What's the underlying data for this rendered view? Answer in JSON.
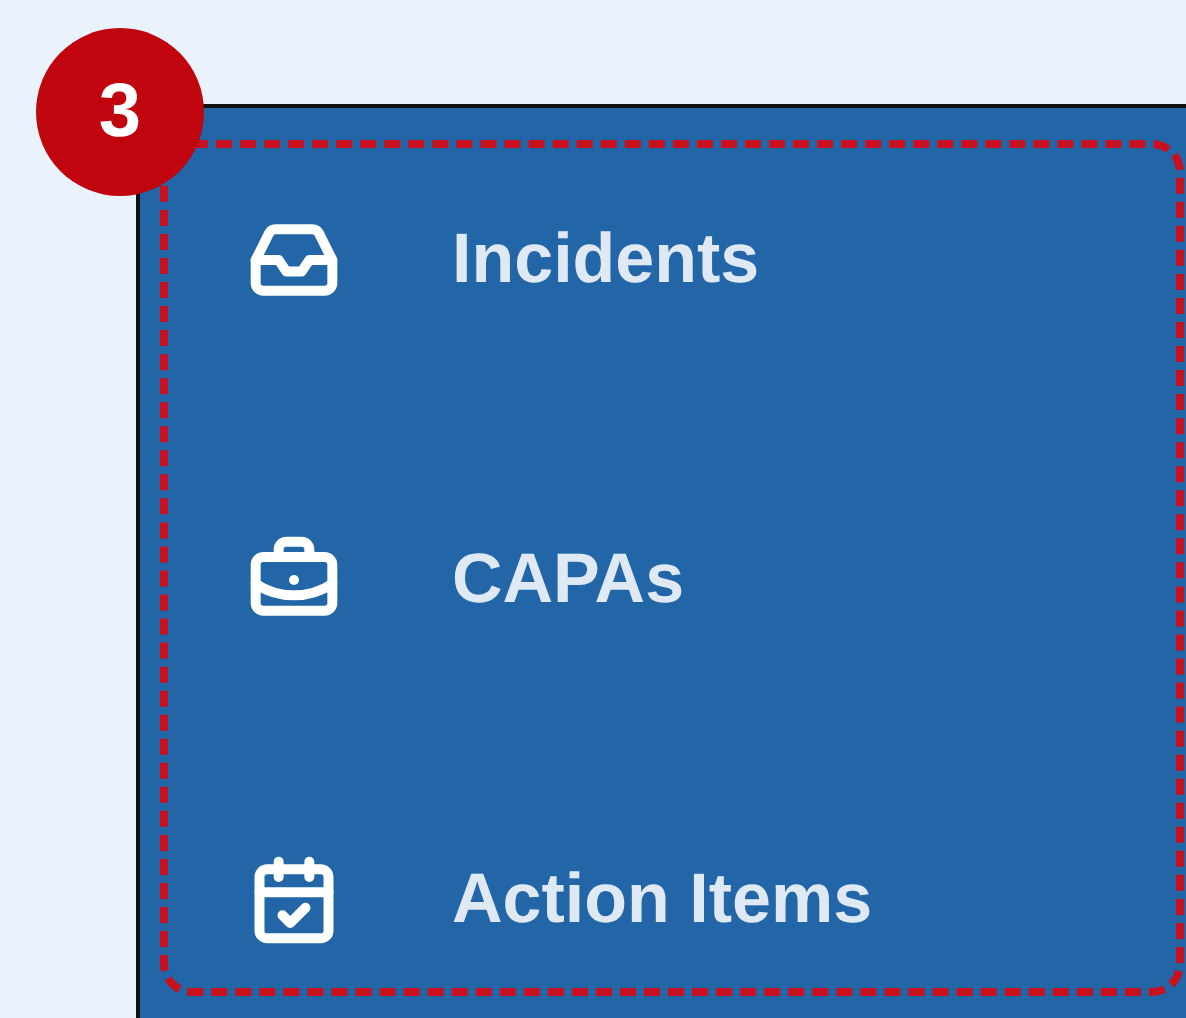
{
  "step_badge": "3",
  "nav_items": [
    {
      "label": "Incidents"
    },
    {
      "label": "CAPAs"
    },
    {
      "label": "Action Items"
    }
  ]
}
